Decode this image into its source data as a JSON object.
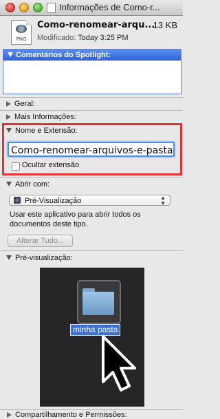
{
  "window": {
    "title": "Informações de Como-r..."
  },
  "header": {
    "file_name": "Como-renomear-arqu...",
    "file_size": "13 KB",
    "modified_label": "Modificado:",
    "modified_value": "Today 3:25 PM",
    "file_icon_badge": "PNG"
  },
  "spotlight": {
    "label": "Comentários do Spotlight:"
  },
  "sections": {
    "general": "Geral:",
    "more_info": "Mais Informações:",
    "name_ext": "Nome e Extensão:",
    "open_with": "Abrir com:",
    "preview": "Pré-visualização:"
  },
  "name_ext": {
    "field_value": "Como-renomear-arquivos-e-pastas-",
    "hide_ext_label": "Ocultar extensão",
    "hide_ext_checked": false
  },
  "open_with": {
    "app": "Pré-Visualização",
    "description": "Usar este aplicativo para abrir todos os documentos deste tipo.",
    "change_all": "Alterar Tudo..."
  },
  "preview": {
    "folder_name": "minha pasta"
  },
  "bottom": {
    "partial_text": "Compartilhamento e Permissões:"
  },
  "colors": {
    "highlight_border": "#e23232",
    "selection": "#3c6fd1",
    "spotlight_header": "#2f62d8"
  },
  "icons": [
    "close-icon",
    "minimize-icon",
    "zoom-icon",
    "png-file-icon",
    "folder-icon",
    "arrow-cursor-icon"
  ]
}
